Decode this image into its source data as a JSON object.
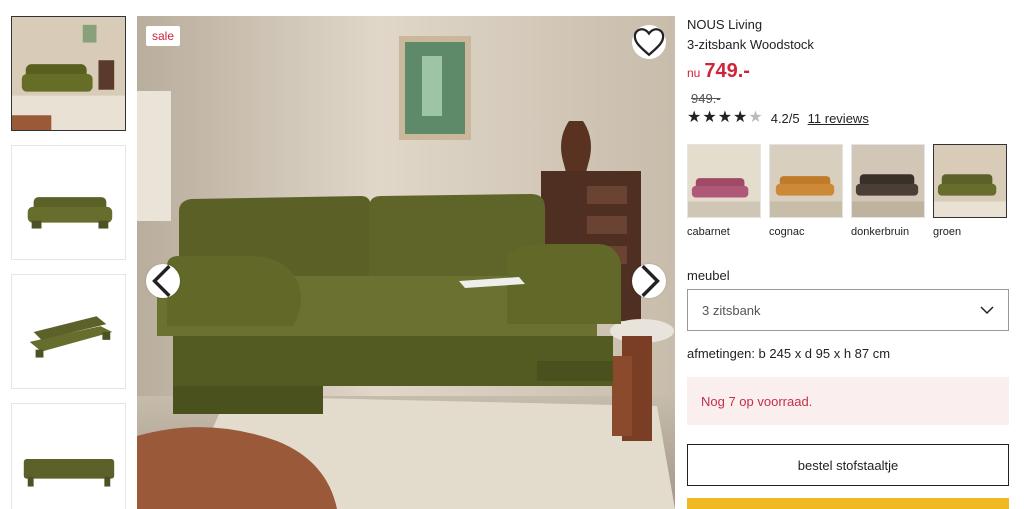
{
  "gallery": {
    "thumbnails": [
      {
        "name": "thumb-room",
        "active": true
      },
      {
        "name": "thumb-front",
        "active": false
      },
      {
        "name": "thumb-angle",
        "active": false
      },
      {
        "name": "thumb-back",
        "active": false
      }
    ],
    "sale_badge": "sale",
    "icons": {
      "favorite": "heart-icon",
      "prev": "chevron-left-icon",
      "next": "chevron-right-icon"
    }
  },
  "product": {
    "brand": "NOUS Living",
    "name": "3-zitsbank Woodstock",
    "price_prefix": "nu",
    "price_now": "749.-",
    "price_old": "949.-",
    "rating_value": 4.2,
    "rating_text": "4.2/5",
    "reviews_link": "11 reviews",
    "colors": [
      {
        "label": "cabarnet",
        "hex": "#a04a68",
        "selected": false
      },
      {
        "label": "cognac",
        "hex": "#c07a2a",
        "selected": false
      },
      {
        "label": "donkerbruin",
        "hex": "#3a302a",
        "selected": false
      },
      {
        "label": "groen",
        "hex": "#5b6128",
        "selected": true
      }
    ],
    "furniture_label": "meubel",
    "furniture_select_value": "3 zitsbank",
    "dimensions": "afmetingen: b 245 x d 95 x h 87 cm",
    "stock_notice": "Nog 7 op voorraad.",
    "sample_button": "bestel stofstaaltje"
  },
  "theme": {
    "accent_red": "#d0243a",
    "stock_bg": "#fbeeee",
    "cta_yellow": "#f1b921"
  }
}
